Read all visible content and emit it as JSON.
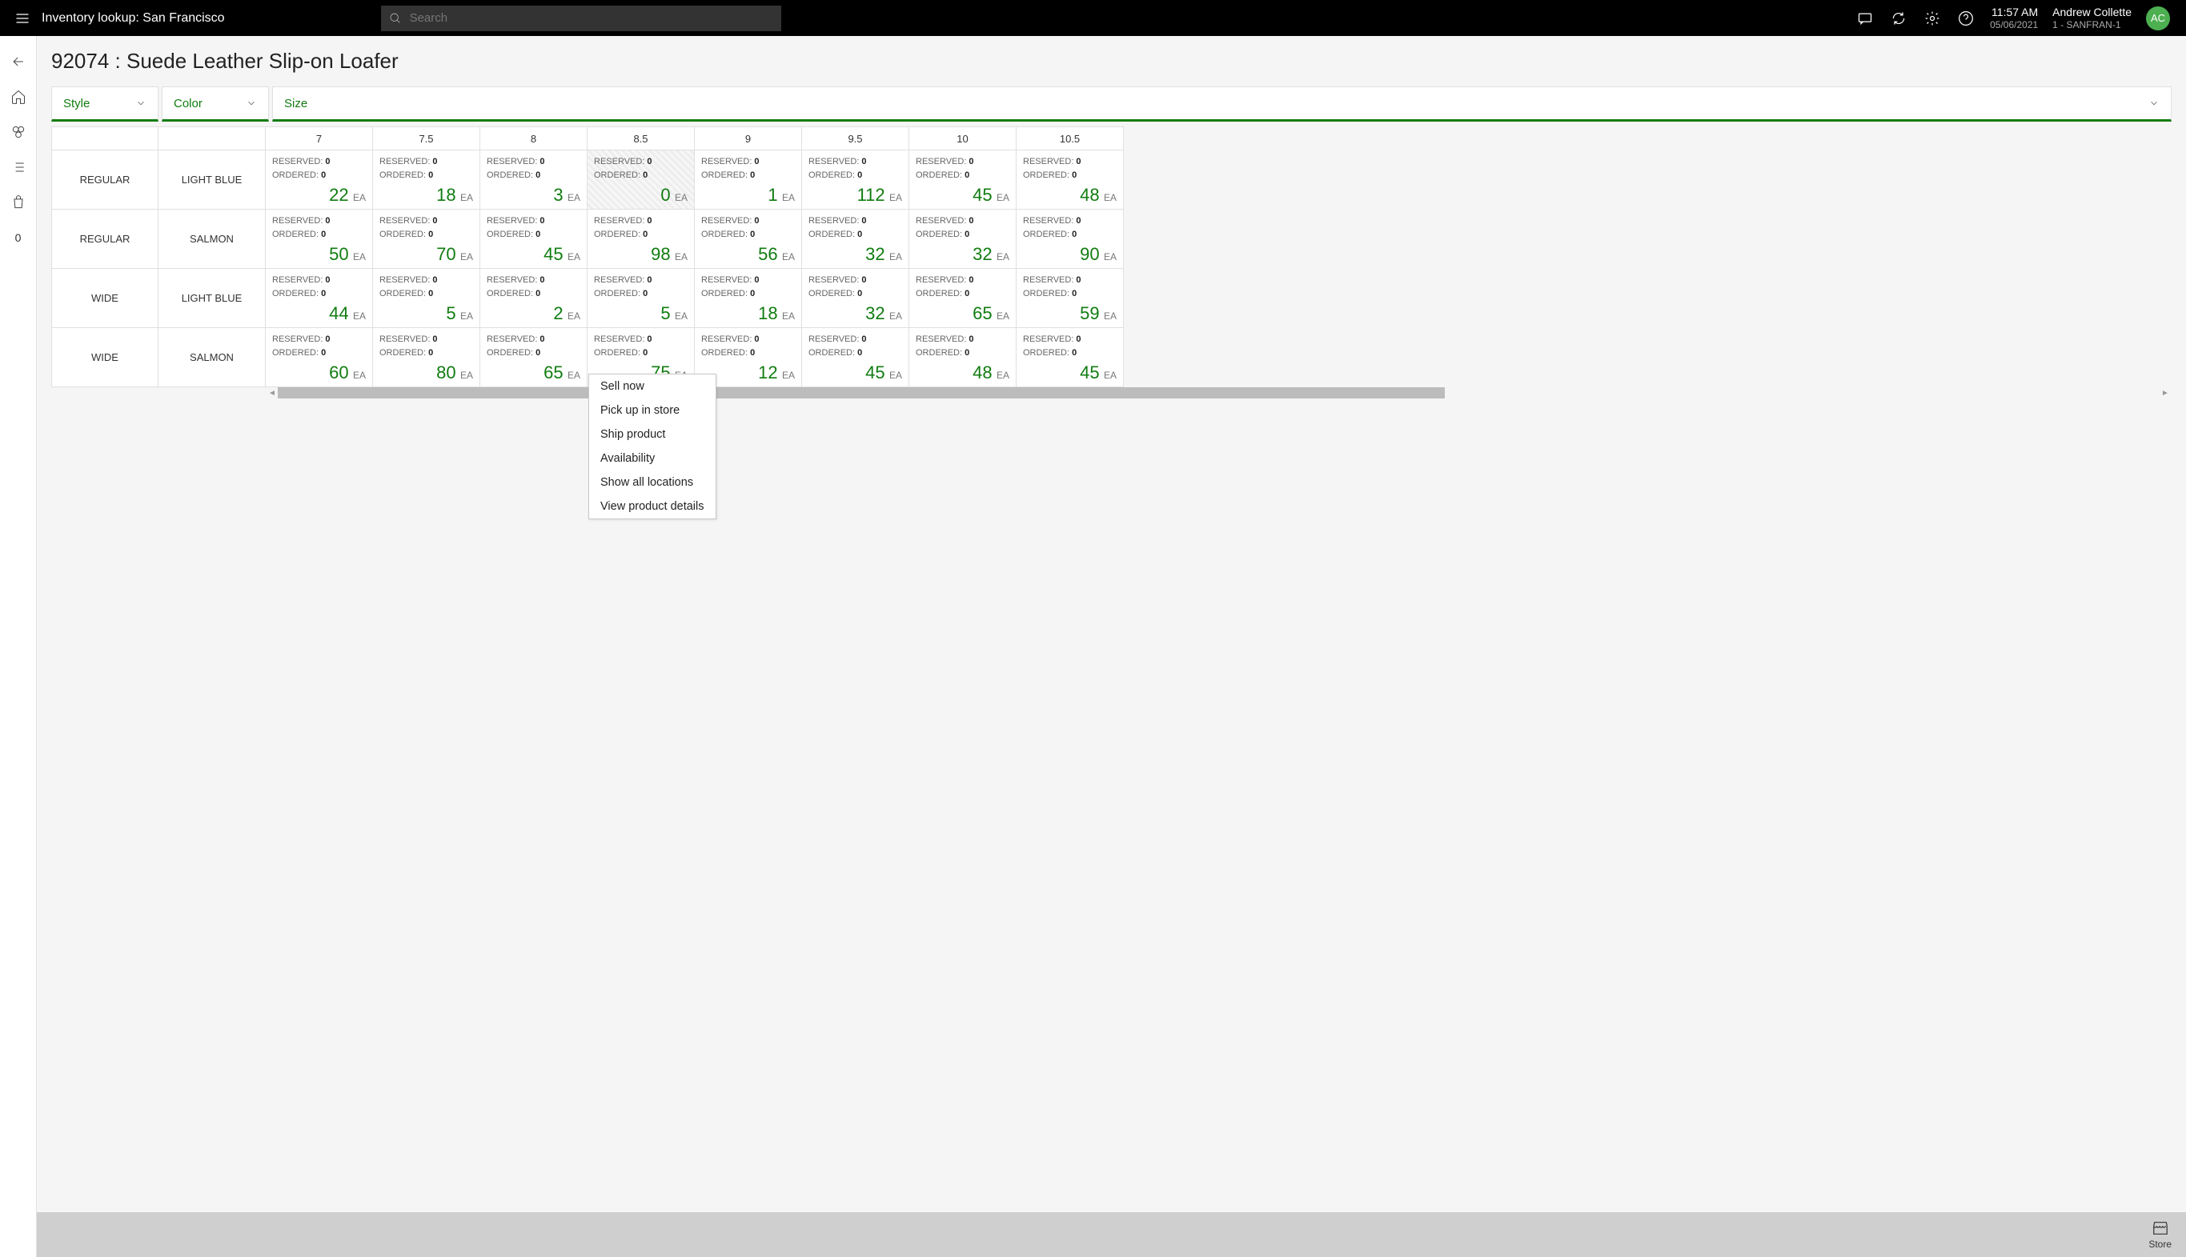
{
  "header": {
    "title": "Inventory lookup: San Francisco",
    "search_placeholder": "Search",
    "time": "11:57 AM",
    "date": "05/06/2021",
    "user_name": "Andrew Collette",
    "store": "1 - SANFRAN-1",
    "avatar_initials": "AC"
  },
  "sidebar": {
    "basket_count": "0"
  },
  "page": {
    "title": "92074 : Suede Leather Slip-on Loafer"
  },
  "dims": {
    "style_label": "Style",
    "color_label": "Color",
    "size_label": "Size"
  },
  "labels": {
    "reserved": "RESERVED:",
    "ordered": "ORDERED:",
    "unit": "EA"
  },
  "sizes": [
    "7",
    "7.5",
    "8",
    "8.5",
    "9",
    "9.5",
    "10",
    "10.5"
  ],
  "rows": [
    {
      "style": "REGULAR",
      "color": "LIGHT BLUE",
      "cells": [
        {
          "reserved": "0",
          "ordered": "0",
          "qty": "22"
        },
        {
          "reserved": "0",
          "ordered": "0",
          "qty": "18"
        },
        {
          "reserved": "0",
          "ordered": "0",
          "qty": "3"
        },
        {
          "reserved": "0",
          "ordered": "0",
          "qty": "0",
          "selected": true
        },
        {
          "reserved": "0",
          "ordered": "0",
          "qty": "1"
        },
        {
          "reserved": "0",
          "ordered": "0",
          "qty": "112"
        },
        {
          "reserved": "0",
          "ordered": "0",
          "qty": "45"
        },
        {
          "reserved": "0",
          "ordered": "0",
          "qty": "48"
        }
      ]
    },
    {
      "style": "REGULAR",
      "color": "SALMON",
      "cells": [
        {
          "reserved": "0",
          "ordered": "0",
          "qty": "50"
        },
        {
          "reserved": "0",
          "ordered": "0",
          "qty": "70"
        },
        {
          "reserved": "0",
          "ordered": "0",
          "qty": "45"
        },
        {
          "reserved": "0",
          "ordered": "0",
          "qty": "98"
        },
        {
          "reserved": "0",
          "ordered": "0",
          "qty": "56"
        },
        {
          "reserved": "0",
          "ordered": "0",
          "qty": "32"
        },
        {
          "reserved": "0",
          "ordered": "0",
          "qty": "32"
        },
        {
          "reserved": "0",
          "ordered": "0",
          "qty": "90"
        }
      ]
    },
    {
      "style": "WIDE",
      "color": "LIGHT BLUE",
      "cells": [
        {
          "reserved": "0",
          "ordered": "0",
          "qty": "44"
        },
        {
          "reserved": "0",
          "ordered": "0",
          "qty": "5"
        },
        {
          "reserved": "0",
          "ordered": "0",
          "qty": "2"
        },
        {
          "reserved": "0",
          "ordered": "0",
          "qty": "5"
        },
        {
          "reserved": "0",
          "ordered": "0",
          "qty": "18"
        },
        {
          "reserved": "0",
          "ordered": "0",
          "qty": "32"
        },
        {
          "reserved": "0",
          "ordered": "0",
          "qty": "65"
        },
        {
          "reserved": "0",
          "ordered": "0",
          "qty": "59"
        }
      ]
    },
    {
      "style": "WIDE",
      "color": "SALMON",
      "cells": [
        {
          "reserved": "0",
          "ordered": "0",
          "qty": "60"
        },
        {
          "reserved": "0",
          "ordered": "0",
          "qty": "80"
        },
        {
          "reserved": "0",
          "ordered": "0",
          "qty": "65"
        },
        {
          "reserved": "0",
          "ordered": "0",
          "qty": "75"
        },
        {
          "reserved": "0",
          "ordered": "0",
          "qty": "12"
        },
        {
          "reserved": "0",
          "ordered": "0",
          "qty": "45"
        },
        {
          "reserved": "0",
          "ordered": "0",
          "qty": "48"
        },
        {
          "reserved": "0",
          "ordered": "0",
          "qty": "45"
        }
      ]
    }
  ],
  "context_menu": {
    "items": [
      "Sell now",
      "Pick up in store",
      "Ship product",
      "Availability",
      "Show all locations",
      "View product details"
    ]
  },
  "footer": {
    "store_label": "Store"
  }
}
